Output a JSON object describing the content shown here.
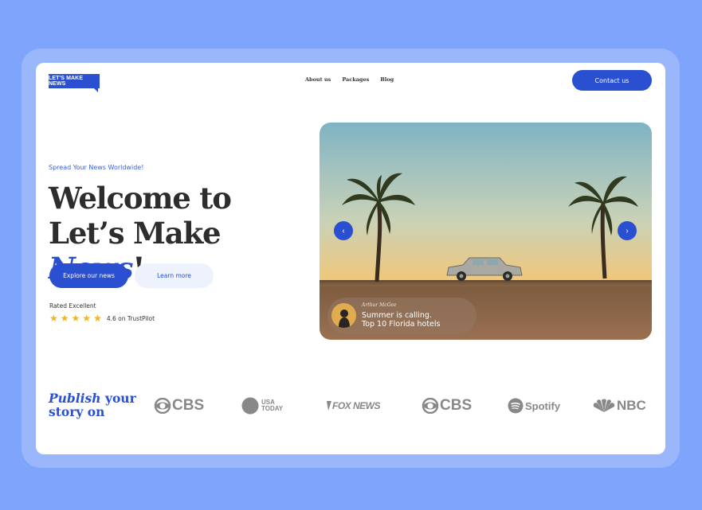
{
  "header": {
    "logo_text": "LET'S MAKE NEWS",
    "nav": [
      "About us",
      "Packages",
      "Blog"
    ],
    "contact_label": "Contact us"
  },
  "hero": {
    "tagline": "Spread Your News Worldwide!",
    "headline_line1": "Welcome to",
    "headline_line2_prefix": "Let’s Make ",
    "headline_accent": "News",
    "headline_suffix": "!",
    "primary_button": "Explore our news",
    "secondary_button": "Learn more",
    "rated_label": "Rated Excellent",
    "rating_stars": 5,
    "rating_text": "4.6 on TrustPilot"
  },
  "slider": {
    "author": "Arthur McGee",
    "caption_line1": "Summer is calling.",
    "caption_line2": "Top 10 Florida hotels",
    "prev_icon": "chevron-left-icon",
    "next_icon": "chevron-right-icon"
  },
  "publish": {
    "word1": "Publish",
    "rest_line1": "your",
    "line2": "story on"
  },
  "brands": [
    {
      "name": "CBS",
      "icon": "cbs-eye-icon"
    },
    {
      "name_line1": "USA",
      "name_line2": "TODAY",
      "icon": "usa-today-dot-icon"
    },
    {
      "name": "FOX NEWS",
      "icon": "fox-news-icon"
    },
    {
      "name": "CBS",
      "icon": "cbs-eye-icon"
    },
    {
      "name": "Spotify",
      "icon": "spotify-icon"
    },
    {
      "name": "NBC",
      "icon": "nbc-peacock-icon"
    }
  ],
  "colors": {
    "accent": "#2a4fd0",
    "background": "#7fa4fb",
    "star": "#f4b41a",
    "brand_gray": "#888888"
  }
}
